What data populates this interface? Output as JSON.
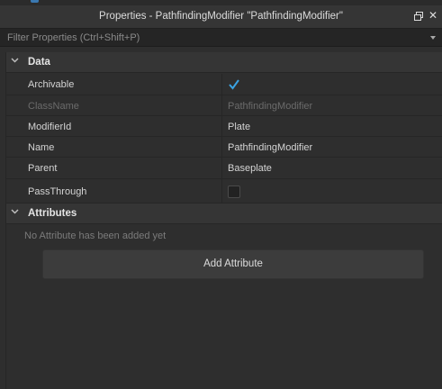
{
  "window": {
    "title": "Properties - PathfindingModifier \"PathfindingModifier\""
  },
  "filter": {
    "placeholder": "Filter Properties (Ctrl+Shift+P)"
  },
  "sections": {
    "data": {
      "label": "Data"
    },
    "attributes": {
      "label": "Attributes"
    }
  },
  "properties": [
    {
      "name": "Archivable",
      "type": "checkbox",
      "checked": true
    },
    {
      "name": "ClassName",
      "value": "PathfindingModifier",
      "disabled": true
    },
    {
      "name": "ModifierId",
      "value": "Plate"
    },
    {
      "name": "Name",
      "value": "PathfindingModifier"
    },
    {
      "name": "Parent",
      "value": "Baseplate"
    },
    {
      "name": "PassThrough",
      "type": "checkbox",
      "checked": false
    }
  ],
  "attributes": {
    "empty_text": "No Attribute has been added yet",
    "add_button_label": "Add Attribute"
  },
  "colors": {
    "background": "#2e2e2e",
    "header": "#353535",
    "check_accent": "#3aa3e3"
  },
  "icons": {
    "float": "float-window-icon",
    "close": "close-icon",
    "dropdown": "chevron-down-icon",
    "section_toggle": "chevron-down-icon",
    "checkmark": "checkmark-icon"
  }
}
